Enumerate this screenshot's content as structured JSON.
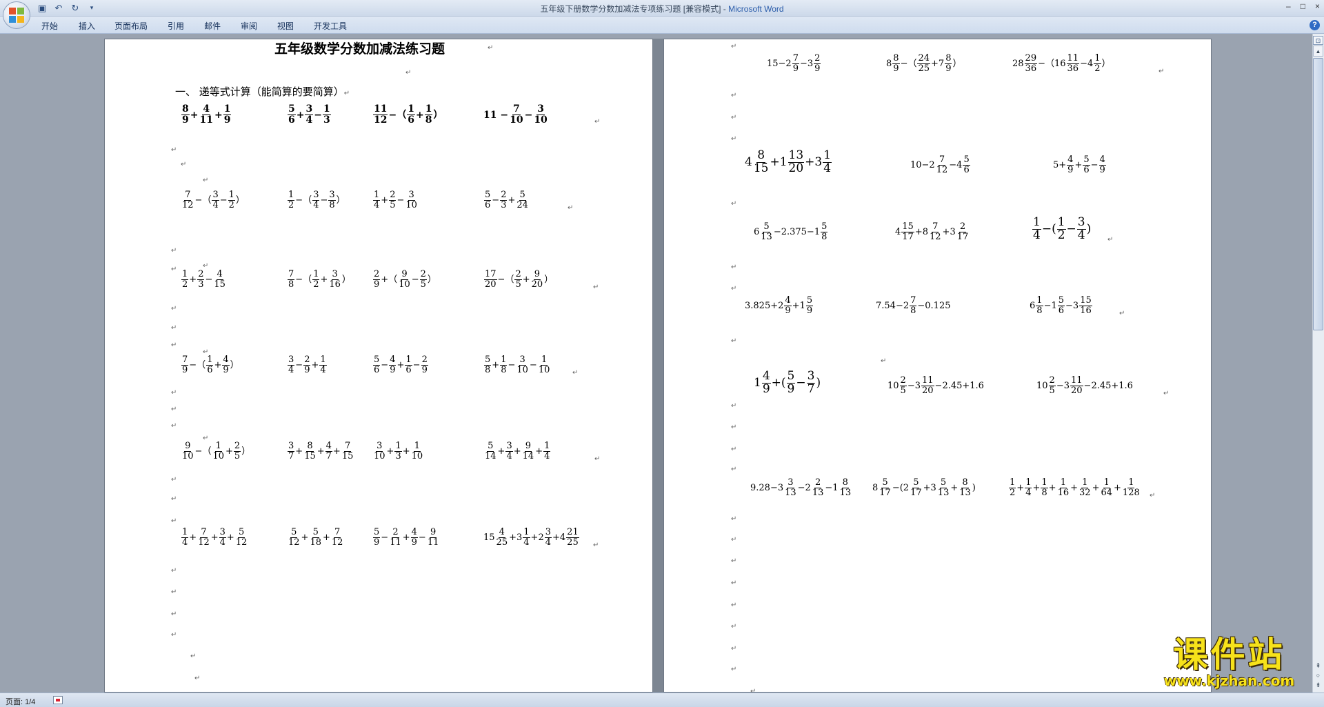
{
  "window": {
    "title": "五年级下册数学分数加减法专项练习题 [兼容模式]",
    "app_name": "Microsoft Word",
    "controls": [
      "–",
      "□",
      "×"
    ]
  },
  "ribbon_tabs": [
    "开始",
    "插入",
    "页面布局",
    "引用",
    "邮件",
    "审阅",
    "视图",
    "开发工具"
  ],
  "document": {
    "title": "五年级数学分数加减法练习题",
    "section": "一、  递等式计算（能简算的要简算）",
    "para_mark": "↵",
    "page1_rows": [
      [
        [
          [
            "f",
            "8",
            "9"
          ],
          "+",
          [
            "f",
            "4",
            "11"
          ],
          "+",
          [
            "f",
            "1",
            "9"
          ]
        ],
        [
          [
            "f",
            "5",
            "6"
          ],
          "+",
          [
            "f",
            "3",
            "4"
          ],
          "−",
          [
            "f",
            "1",
            "3"
          ]
        ],
        [
          [
            "f",
            "11",
            "12"
          ],
          "−（",
          [
            "f",
            "1",
            "6"
          ],
          "+",
          [
            "f",
            "1",
            "8"
          ],
          "）"
        ],
        [
          "11 −",
          [
            "f",
            "7",
            "10"
          ],
          "−",
          [
            "f",
            "3",
            "10"
          ]
        ]
      ],
      [
        [
          [
            "f",
            "7",
            "12"
          ],
          "−（",
          [
            "f",
            "3",
            "4"
          ],
          "−",
          [
            "f",
            "1",
            "2"
          ],
          "）"
        ],
        [
          [
            "f",
            "1",
            "2"
          ],
          "−（",
          [
            "f",
            "3",
            "4"
          ],
          "−",
          [
            "f",
            "3",
            "8"
          ],
          "）"
        ],
        [
          [
            "f",
            "1",
            "4"
          ],
          "+",
          [
            "f",
            "2",
            "5"
          ],
          "−",
          [
            "f",
            "3",
            "10"
          ]
        ],
        [
          [
            "f",
            "5",
            "6"
          ],
          "−",
          [
            "f",
            "2",
            "3"
          ],
          "+",
          [
            "f",
            "5",
            "24"
          ]
        ]
      ],
      [
        [
          [
            "f",
            "1",
            "2"
          ],
          "+",
          [
            "f",
            "2",
            "3"
          ],
          "−",
          [
            "f",
            "4",
            "15"
          ]
        ],
        [
          [
            "f",
            "7",
            "8"
          ],
          "−（",
          [
            "f",
            "1",
            "2"
          ],
          "+",
          [
            "f",
            "3",
            "16"
          ],
          "）"
        ],
        [
          [
            "f",
            "2",
            "9"
          ],
          "+（",
          [
            "f",
            "9",
            "10"
          ],
          "−",
          [
            "f",
            "2",
            "5"
          ],
          "）"
        ],
        [
          [
            "f",
            "17",
            "20"
          ],
          "−（",
          [
            "f",
            "2",
            "5"
          ],
          "+",
          [
            "f",
            "9",
            "20"
          ],
          "）"
        ]
      ],
      [
        [
          [
            "f",
            "7",
            "9"
          ],
          "−（",
          [
            "f",
            "1",
            "6"
          ],
          "+",
          [
            "f",
            "4",
            "9"
          ],
          "）"
        ],
        [
          [
            "f",
            "3",
            "4"
          ],
          "−",
          [
            "f",
            "2",
            "9"
          ],
          "+",
          [
            "f",
            "1",
            "4"
          ]
        ],
        [
          [
            "f",
            "5",
            "6"
          ],
          "−",
          [
            "f",
            "4",
            "9"
          ],
          "+",
          [
            "f",
            "1",
            "6"
          ],
          "−",
          [
            "f",
            "2",
            "9"
          ]
        ],
        [
          [
            "f",
            "5",
            "8"
          ],
          "+",
          [
            "f",
            "1",
            "8"
          ],
          "−",
          [
            "f",
            "3",
            "10"
          ],
          "−",
          [
            "f",
            "1",
            "10"
          ]
        ]
      ],
      [
        [
          [
            "f",
            "9",
            "10"
          ],
          "−（",
          [
            "f",
            "1",
            "10"
          ],
          "+",
          [
            "f",
            "2",
            "5"
          ],
          "）"
        ],
        [
          [
            "f",
            "3",
            "7"
          ],
          "+",
          [
            "f",
            "8",
            "15"
          ],
          "+",
          [
            "f",
            "4",
            "7"
          ],
          "+",
          [
            "f",
            "7",
            "15"
          ]
        ],
        [
          [
            "f",
            "3",
            "10"
          ],
          "+",
          [
            "f",
            "1",
            "3"
          ],
          "+",
          [
            "f",
            "1",
            "10"
          ]
        ],
        [
          [
            "f",
            "5",
            "14"
          ],
          "+",
          [
            "f",
            "3",
            "4"
          ],
          "+",
          [
            "f",
            "9",
            "14"
          ],
          "+",
          [
            "f",
            "1",
            "4"
          ]
        ]
      ],
      [
        [
          [
            "f",
            "1",
            "4"
          ],
          "+",
          [
            "f",
            "7",
            "12"
          ],
          "+",
          [
            "f",
            "3",
            "4"
          ],
          "+",
          [
            "f",
            "5",
            "12"
          ]
        ],
        [
          [
            "f",
            "5",
            "12"
          ],
          "+",
          [
            "f",
            "5",
            "18"
          ],
          "+",
          [
            "f",
            "7",
            "12"
          ]
        ],
        [
          [
            "f",
            "5",
            "9"
          ],
          "−",
          [
            "f",
            "2",
            "11"
          ],
          "+",
          [
            "f",
            "4",
            "9"
          ],
          "−",
          [
            "f",
            "9",
            "11"
          ]
        ],
        [
          "15",
          [
            "f",
            "4",
            "25"
          ],
          "+3",
          [
            "f",
            "1",
            "4"
          ],
          "+2",
          [
            "f",
            "3",
            "4"
          ],
          "+4",
          [
            "f",
            "21",
            "25"
          ]
        ]
      ]
    ],
    "page2_rows": [
      [
        [
          "15−2",
          [
            "f",
            "7",
            "9"
          ],
          "−3",
          [
            "f",
            "2",
            "9"
          ]
        ],
        [
          "8",
          [
            "f",
            "8",
            "9"
          ],
          "−（",
          [
            "f",
            "24",
            "25"
          ],
          "+7",
          [
            "f",
            "8",
            "9"
          ],
          "）"
        ],
        [
          "28",
          [
            "f",
            "29",
            "36"
          ],
          "−（16",
          [
            "f",
            "11",
            "36"
          ],
          "−4",
          [
            "f",
            "1",
            "2"
          ],
          "）"
        ]
      ],
      [
        [
          "4",
          [
            "f",
            "8",
            "15"
          ],
          "+1",
          [
            "f",
            "13",
            "20"
          ],
          "+3",
          [
            "f",
            "1",
            "4"
          ]
        ],
        [
          "10−2",
          [
            "f",
            "7",
            "12"
          ],
          "−4",
          [
            "f",
            "5",
            "6"
          ]
        ],
        [
          "5+",
          [
            "f",
            "4",
            "9"
          ],
          "+",
          [
            "f",
            "5",
            "6"
          ],
          "−",
          [
            "f",
            "4",
            "9"
          ]
        ]
      ],
      [
        [
          "6",
          [
            "f",
            "5",
            "13"
          ],
          "−2.375−1",
          [
            "f",
            "5",
            "8"
          ]
        ],
        [
          "4",
          [
            "f",
            "15",
            "17"
          ],
          "+8",
          [
            "f",
            "7",
            "12"
          ],
          "+3",
          [
            "f",
            "2",
            "17"
          ]
        ],
        [
          [
            "f",
            "1",
            "4"
          ],
          "−(",
          [
            "f",
            "1",
            "2"
          ],
          "−",
          [
            "f",
            "3",
            "4"
          ],
          ")"
        ]
      ],
      [
        [
          "3.825+2",
          [
            "f",
            "4",
            "9"
          ],
          "+1",
          [
            "f",
            "5",
            "9"
          ]
        ],
        [
          "7.54−2",
          [
            "f",
            "7",
            "8"
          ],
          "−0.125"
        ],
        [
          "6",
          [
            "f",
            "1",
            "8"
          ],
          "−1",
          [
            "f",
            "5",
            "6"
          ],
          "−3",
          [
            "f",
            "15",
            "16"
          ]
        ]
      ],
      [
        [
          "1",
          [
            "f",
            "4",
            "9"
          ],
          "+(",
          [
            "f",
            "5",
            "9"
          ],
          "−",
          [
            "f",
            "3",
            "7"
          ],
          ")"
        ],
        [
          "10",
          [
            "f",
            "2",
            "5"
          ],
          "−3",
          [
            "f",
            "11",
            "20"
          ],
          "−2.45+1.6"
        ],
        [
          "10",
          [
            "f",
            "2",
            "5"
          ],
          "−3",
          [
            "f",
            "11",
            "20"
          ],
          "−2.45+1.6"
        ]
      ],
      [
        [
          "9.28−3",
          [
            "f",
            "3",
            "13"
          ],
          "−2",
          [
            "f",
            "2",
            "13"
          ],
          "−1",
          [
            "f",
            "8",
            "13"
          ]
        ],
        [
          "8",
          [
            "f",
            "5",
            "17"
          ],
          "−(2",
          [
            "f",
            "5",
            "17"
          ],
          "+3",
          [
            "f",
            "5",
            "13"
          ],
          "+",
          [
            "f",
            "8",
            "13"
          ],
          ")"
        ],
        [
          [
            "f",
            "1",
            "2"
          ],
          "+",
          [
            "f",
            "1",
            "4"
          ],
          "+",
          [
            "f",
            "1",
            "8"
          ],
          "+",
          [
            "f",
            "1",
            "16"
          ],
          "+",
          [
            "f",
            "1",
            "32"
          ],
          "+",
          [
            "f",
            "1",
            "64"
          ],
          "+",
          [
            "f",
            "1",
            "128"
          ]
        ]
      ]
    ]
  },
  "status": {
    "page": "页面: 1/4"
  },
  "watermark": {
    "title": "课件站",
    "url": "www.kjzhan.com"
  },
  "colors": {
    "app_name": "#2a5caa",
    "watermark": "#f7e21a"
  }
}
